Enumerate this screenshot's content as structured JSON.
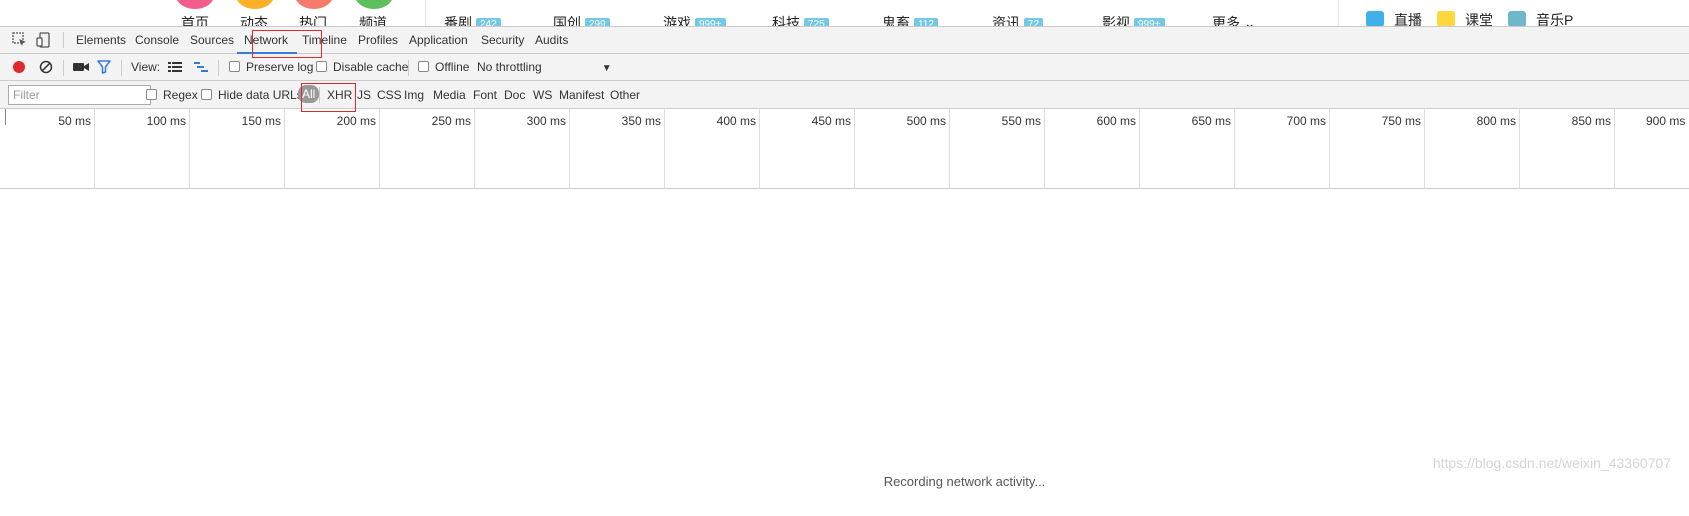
{
  "site": {
    "nav": [
      "首页",
      "动态",
      "热门",
      "频道"
    ],
    "nav_colors": [
      "#f25d8e",
      "#ffb027",
      "#f77a6c",
      "#5cc05c"
    ],
    "categories": [
      {
        "label": "番剧",
        "badge": "242"
      },
      {
        "label": "国创",
        "badge": "299"
      },
      {
        "label": "游戏",
        "badge": "999+"
      },
      {
        "label": "科技",
        "badge": "725"
      },
      {
        "label": "鬼畜",
        "badge": "112"
      },
      {
        "label": "资讯",
        "badge": "72"
      },
      {
        "label": "影视",
        "badge": "999+"
      }
    ],
    "more": "更多",
    "right_links": [
      {
        "label": "直播",
        "icon": "live-user-icon",
        "color": "#3fb0e8"
      },
      {
        "label": "课堂",
        "icon": "classroom-face-icon",
        "color": "#ffd83d"
      },
      {
        "label": "音乐P",
        "icon": "music-icon",
        "color": "#6fb8c9"
      }
    ]
  },
  "devtools": {
    "tools": {
      "inspect": "inspect-element-icon",
      "device": "device-toolbar-icon"
    },
    "tabs": [
      "Elements",
      "Console",
      "Sources",
      "Network",
      "Timeline",
      "Profiles",
      "Application",
      "Security",
      "Audits"
    ],
    "active_tab": "Network",
    "toolbar": {
      "record_color": "#e0292f",
      "view_label": "View:",
      "preserve_log": "Preserve log",
      "disable_cache": "Disable cache",
      "offline": "Offline",
      "throttling": "No throttling"
    },
    "filter": {
      "placeholder": "Filter",
      "regex": "Regex",
      "hide_data_urls": "Hide data URLs",
      "types": [
        "All",
        "XHR",
        "JS",
        "CSS",
        "Img",
        "Media",
        "Font",
        "Doc",
        "WS",
        "Manifest",
        "Other"
      ],
      "active_type": "All"
    },
    "timeline_ticks": [
      "50 ms",
      "100 ms",
      "150 ms",
      "200 ms",
      "250 ms",
      "300 ms",
      "350 ms",
      "400 ms",
      "450 ms",
      "500 ms",
      "550 ms",
      "600 ms",
      "650 ms",
      "700 ms",
      "750 ms",
      "800 ms",
      "850 ms",
      "900 ms"
    ],
    "status": "Recording network activity...",
    "watermark": "https://blog.csdn.net/weixin_43360707"
  },
  "highlight_color": "#e0292f"
}
